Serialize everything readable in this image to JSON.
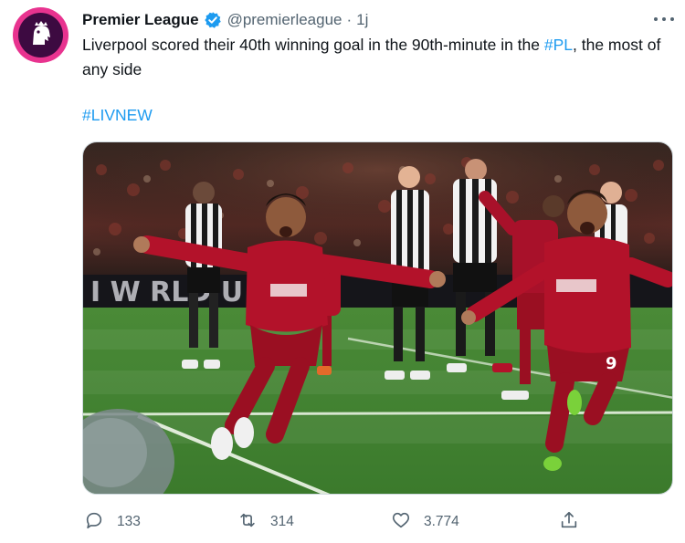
{
  "account": {
    "name": "Premier League",
    "handle": "@premierleague",
    "separator": "·",
    "time": "1j"
  },
  "tweet": {
    "text_before": "Liverpool scored their 40th winning goal in the 90th-minute in the ",
    "hashtag_inline": "#PL",
    "text_after": ", the most of any side",
    "hashtag": "#LIVNEW"
  },
  "media": {
    "board_text": "I W  RLD  U  I  L",
    "sponsor": "Standard Chartered",
    "shirt_number": "9"
  },
  "actions": {
    "replies": "133",
    "retweets": "314",
    "likes": "3.774"
  },
  "colors": {
    "brand": "#e8338f",
    "link": "#1d9bf0",
    "liverpool_red": "#b3122a",
    "pitch": "#4e8a3a"
  },
  "icons": [
    "premier-league-lion-icon",
    "verified-badge-icon",
    "more-icon",
    "reply-icon",
    "retweet-icon",
    "like-icon",
    "share-icon"
  ]
}
